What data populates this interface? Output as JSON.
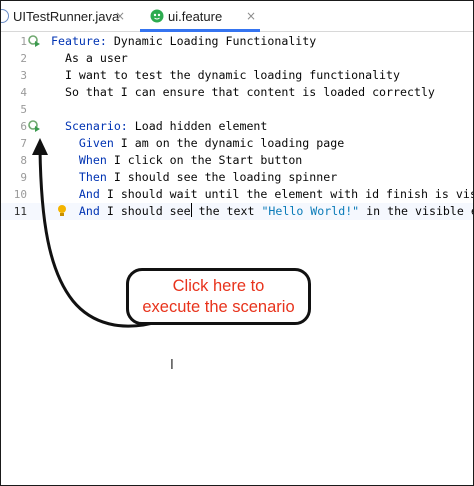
{
  "tabs": [
    {
      "label": "UITestRunner.java",
      "icon": "java-class-icon",
      "active": false
    },
    {
      "label": "ui.feature",
      "icon": "cucumber-icon",
      "active": true
    }
  ],
  "tab_close_glyph": "×",
  "editor": {
    "lines": [
      {
        "num": "1",
        "parts": [
          {
            "t": "Feature:",
            "c": "kw"
          },
          {
            "t": " Dynamic Loading Functionality",
            "c": ""
          }
        ]
      },
      {
        "num": "2",
        "parts": [
          {
            "t": "  As a user",
            "c": ""
          }
        ]
      },
      {
        "num": "3",
        "parts": [
          {
            "t": "  I want to test the dynamic loading functionality",
            "c": ""
          }
        ]
      },
      {
        "num": "4",
        "parts": [
          {
            "t": "  So that I can ensure that content is loaded correctly",
            "c": ""
          }
        ]
      },
      {
        "num": "5",
        "parts": []
      },
      {
        "num": "6",
        "parts": [
          {
            "t": "  Scenario:",
            "c": "kw"
          },
          {
            "t": " Load hidden element",
            "c": ""
          }
        ]
      },
      {
        "num": "7",
        "parts": [
          {
            "t": "    Given",
            "c": "kw"
          },
          {
            "t": " I am on the dynamic loading page",
            "c": ""
          }
        ]
      },
      {
        "num": "8",
        "parts": [
          {
            "t": "    When",
            "c": "kw"
          },
          {
            "t": " I click on the Start button",
            "c": ""
          }
        ]
      },
      {
        "num": "9",
        "parts": [
          {
            "t": "    Then",
            "c": "kw"
          },
          {
            "t": " I should see the loading spinner",
            "c": ""
          }
        ]
      },
      {
        "num": "10",
        "parts": [
          {
            "t": "    And",
            "c": "kw"
          },
          {
            "t": " I should wait until the element with id finish is visible",
            "c": ""
          }
        ]
      },
      {
        "num": "11",
        "parts": [
          {
            "t": "    And",
            "c": "kw"
          },
          {
            "t": " I should see",
            "c": ""
          },
          {
            "t": "",
            "c": "caret"
          },
          {
            "t": " the text ",
            "c": ""
          },
          {
            "t": "\"Hello World!\"",
            "c": "str"
          },
          {
            "t": " in the visible element",
            "c": ""
          }
        ]
      }
    ],
    "current_line": "11",
    "run_icon_lines": [
      "1",
      "6"
    ],
    "bulb_line": "11"
  },
  "annotation": {
    "line1": "Click here to",
    "line2": "execute the scenario"
  },
  "colors": {
    "keyword": "#0033b3",
    "string": "#0a7bb8",
    "annotation_text": "#e8331c",
    "tab_underline": "#3574f0",
    "run_icon": "#3a9a4e"
  }
}
